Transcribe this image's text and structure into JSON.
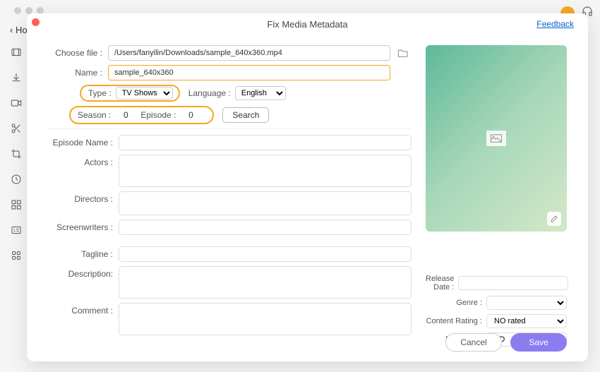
{
  "window": {
    "title": "Fix Media Metadata",
    "feedback_label": "Feedback",
    "back_label": "‹  Ho"
  },
  "form": {
    "choose_file_label": "Choose file :",
    "choose_file_value": "/Users/fanyilin/Downloads/sample_640x360.mp4",
    "name_label": "Name :",
    "name_value": "sample_640x360",
    "type_label": "Type :",
    "type_value": "TV Shows",
    "language_label": "Language :",
    "language_value": "English",
    "season_label": "Season :",
    "season_value": "0",
    "episode_label": "Episode :",
    "episode_value": "0",
    "search_label": "Search"
  },
  "meta": {
    "episode_name_label": "Episode Name :",
    "actors_label": "Actors :",
    "directors_label": "Directors :",
    "screenwriters_label": "Screenwriters :",
    "tagline_label": "Tagline :",
    "description_label": "Description:",
    "comment_label": "Comment :"
  },
  "side": {
    "release_date_label": "Release Date :",
    "genre_label": "Genre :",
    "content_rating_label": "Content Rating :",
    "content_rating_value": "NO rated",
    "definition_label": "Definition :",
    "definition_value": "SD"
  },
  "footer": {
    "cancel_label": "Cancel",
    "save_label": "Save"
  }
}
